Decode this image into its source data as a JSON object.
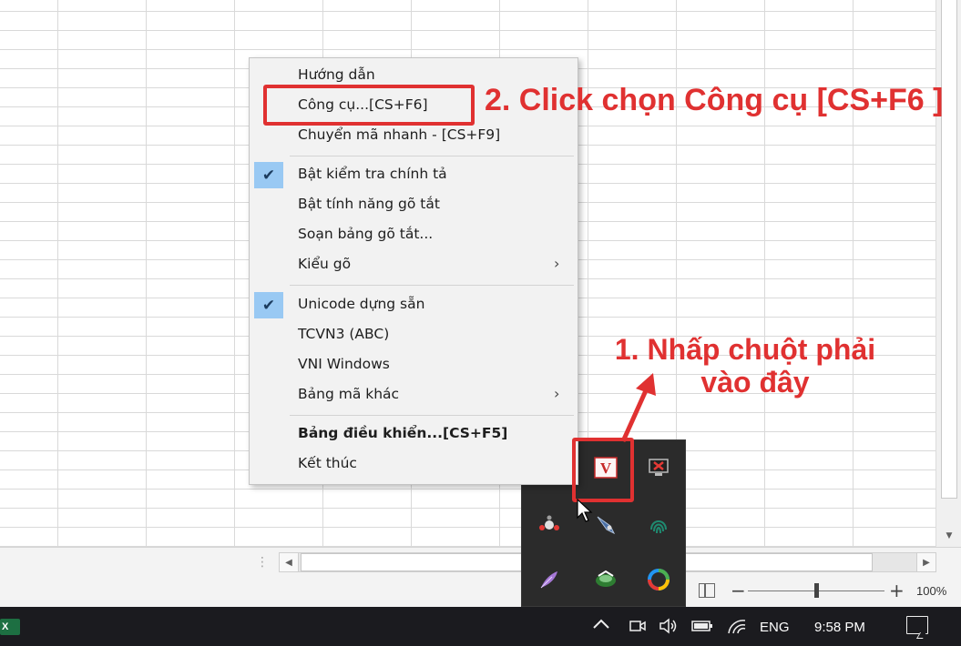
{
  "context_menu": {
    "items": [
      {
        "label": "Hướng dẫn",
        "checked": false,
        "submenu": false,
        "bold": false
      },
      {
        "label": "Công cụ...[CS+F6]",
        "checked": false,
        "submenu": false,
        "bold": false
      },
      {
        "label": "Chuyển mã nhanh - [CS+F9]",
        "checked": false,
        "submenu": false,
        "bold": false
      },
      {
        "label": "Bật kiểm tra chính tả",
        "checked": true,
        "submenu": false,
        "bold": false
      },
      {
        "label": "Bật tính năng gõ tắt",
        "checked": false,
        "submenu": false,
        "bold": false
      },
      {
        "label": "Soạn bảng gõ tắt...",
        "checked": false,
        "submenu": false,
        "bold": false
      },
      {
        "label": "Kiểu gõ",
        "checked": false,
        "submenu": true,
        "bold": false
      },
      {
        "label": "Unicode dựng sẵn",
        "checked": true,
        "submenu": false,
        "bold": false
      },
      {
        "label": "TCVN3 (ABC)",
        "checked": false,
        "submenu": false,
        "bold": false
      },
      {
        "label": "VNI Windows",
        "checked": false,
        "submenu": false,
        "bold": false
      },
      {
        "label": "Bảng mã khác",
        "checked": false,
        "submenu": true,
        "bold": false
      },
      {
        "label": "Bảng điều khiển...[CS+F5]",
        "checked": false,
        "submenu": false,
        "bold": true
      },
      {
        "label": "Kết thúc",
        "checked": false,
        "submenu": false,
        "bold": false
      }
    ]
  },
  "annotations": {
    "step2": "2. Click chọn Công cụ [CS+F6 ]",
    "step1_line1": "1. Nhấp chuột phải",
    "step1_line2": "vào đây",
    "color": "#e03131"
  },
  "tray_popup": {
    "icons": [
      "unikey-v-icon",
      "network-error-icon",
      "molecule-app-icon",
      "rocket-app-icon",
      "fingerprint-icon",
      "feather-app-icon",
      "network-globe-icon",
      "edge-browser-icon"
    ]
  },
  "status_bar": {
    "zoom_minus": "−",
    "zoom_plus": "+",
    "zoom_level": "100%"
  },
  "taskbar": {
    "app_icon": "X",
    "language": "ENG",
    "time": "9:58 PM"
  },
  "glyphs": {
    "check": "✔",
    "submenu_arrow": "›",
    "tray_chevron": "^",
    "scroll_left": "◀",
    "scroll_right": "▶",
    "scroll_down": "▼"
  }
}
